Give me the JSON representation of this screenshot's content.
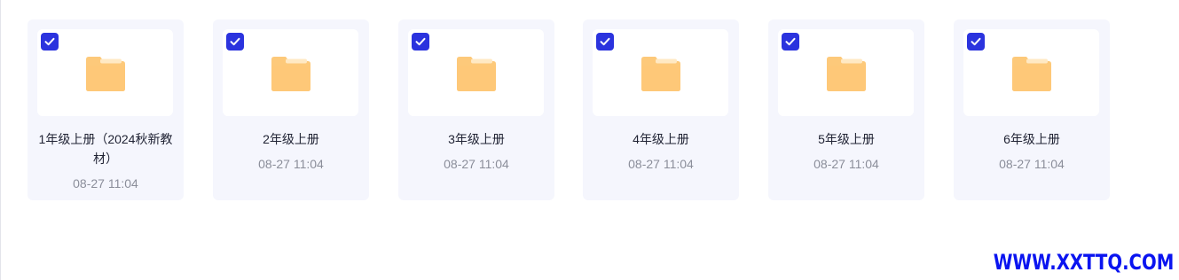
{
  "colors": {
    "card_bg": "#f5f6fd",
    "checkbox": "#2b33de",
    "folder": "#fdc97a",
    "folder_tab": "#ffe3b3",
    "date_text": "#8b8e9a",
    "watermark": "#0a14f0"
  },
  "folders": [
    {
      "name": "1年级上册（2024秋新教材）",
      "date": "08-27 11:04",
      "selected": true,
      "icon": "folder-icon"
    },
    {
      "name": "2年级上册",
      "date": "08-27 11:04",
      "selected": true,
      "icon": "folder-icon"
    },
    {
      "name": "3年级上册",
      "date": "08-27 11:04",
      "selected": true,
      "icon": "folder-icon"
    },
    {
      "name": "4年级上册",
      "date": "08-27 11:04",
      "selected": true,
      "icon": "folder-icon"
    },
    {
      "name": "5年级上册",
      "date": "08-27 11:04",
      "selected": true,
      "icon": "folder-icon"
    },
    {
      "name": "6年级上册",
      "date": "08-27 11:04",
      "selected": true,
      "icon": "folder-icon"
    }
  ],
  "watermark": "WWW.XXTTQ.COM"
}
